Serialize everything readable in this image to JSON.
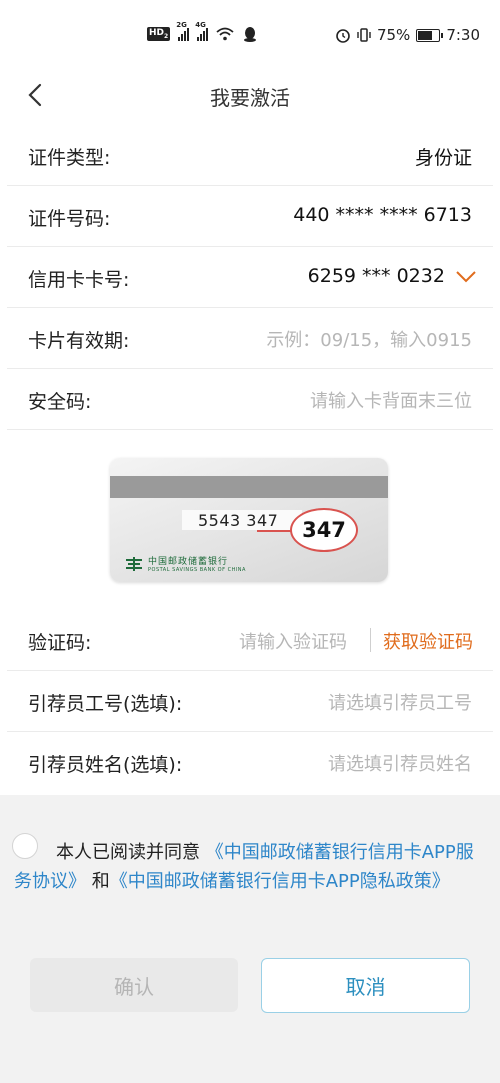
{
  "status_bar": {
    "hd": "HD",
    "hd_sub": "2",
    "net1": "2G",
    "net2": "4G",
    "battery": "75%",
    "time": "7:30"
  },
  "header": {
    "title": "我要激活"
  },
  "form": {
    "id_type": {
      "label": "证件类型:",
      "value": "身份证"
    },
    "id_number": {
      "label": "证件号码:",
      "value": "440 **** **** 6713"
    },
    "card_number": {
      "label": "信用卡卡号:",
      "value": "6259 *** 0232"
    },
    "expiry": {
      "label": "卡片有效期:",
      "placeholder": "示例：09/15，输入0915"
    },
    "cvv": {
      "label": "安全码:",
      "placeholder": "请输入卡背面末三位"
    }
  },
  "card_illustration": {
    "number": "5543 347",
    "cvv": "347",
    "bank_cn": "中国邮政储蓄银行",
    "bank_en": "POSTAL SAVINGS BANK OF CHINA"
  },
  "form2": {
    "verify": {
      "label": "验证码:",
      "placeholder": "请输入验证码",
      "action": "获取验证码"
    },
    "referrer_id": {
      "label": "引荐员工号(选填):",
      "placeholder": "请选填引荐员工号"
    },
    "referrer_name": {
      "label": "引荐员姓名(选填):",
      "placeholder": "请选填引荐员姓名"
    }
  },
  "agreement": {
    "prefix": "本人已阅读并同意",
    "link1": "《中国邮政储蓄银行信用卡APP服务协议》",
    "and": "和",
    "link2": "《中国邮政储蓄银行信用卡APP隐私政策》"
  },
  "buttons": {
    "confirm": "确认",
    "cancel": "取消"
  },
  "colors": {
    "accent_orange": "#e06c1d",
    "link_blue": "#2e86c9",
    "cvv_red": "#d9534f"
  }
}
